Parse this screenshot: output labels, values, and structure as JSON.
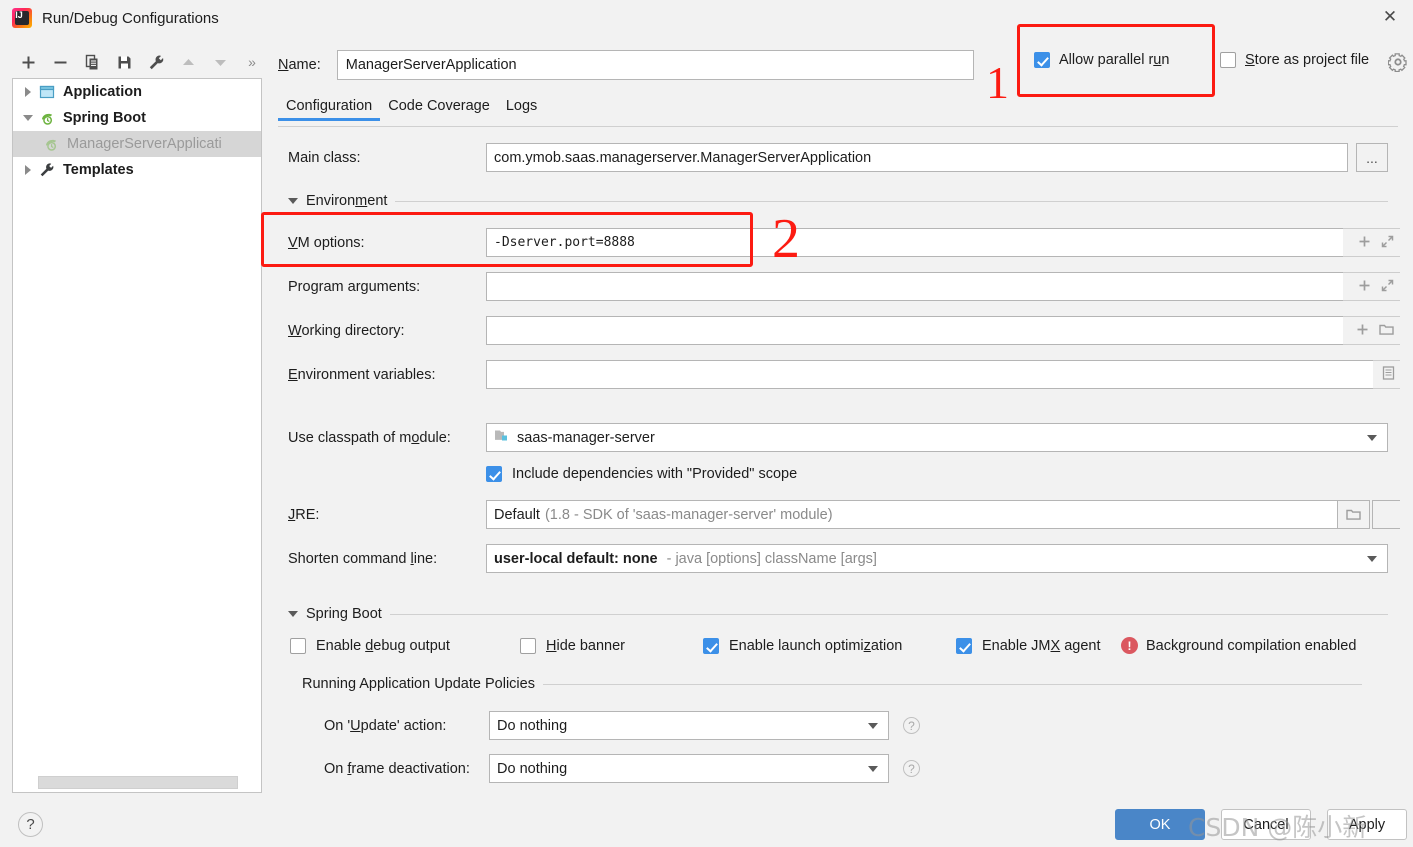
{
  "window": {
    "title": "Run/Debug Configurations",
    "app_icon": "intellij-idea-icon",
    "close_icon": "✕"
  },
  "toolbar": {
    "add_label": "+",
    "remove_label": "−",
    "copy_label": "copy-icon",
    "save_label": "save-icon",
    "edit_templates_label": "wrench-icon",
    "move_up_label": "move-up-icon",
    "move_down_label": "move-down-icon",
    "more_label": "»"
  },
  "tree": {
    "items": [
      {
        "label": "Application",
        "icon": "application-icon",
        "expanded": false,
        "selected": false,
        "child": false
      },
      {
        "label": "Spring Boot",
        "icon": "spring-boot-icon",
        "expanded": true,
        "selected": false,
        "child": false
      },
      {
        "label": "ManagerServerApplicati",
        "icon": "spring-boot-icon",
        "expanded": null,
        "selected": true,
        "child": true
      },
      {
        "label": "Templates",
        "icon": "wrench-icon",
        "expanded": false,
        "selected": false,
        "child": false
      }
    ]
  },
  "header": {
    "name_label": "Name:",
    "name_value": "ManagerServerApplication",
    "allow_parallel_run_label": "Allow parallel run",
    "allow_parallel_run_checked": true,
    "store_as_project_file_label": "Store as project file",
    "store_as_project_file_checked": false,
    "gear_icon": "gear-icon"
  },
  "tabs": [
    {
      "label": "Configuration",
      "active": true
    },
    {
      "label": "Code Coverage",
      "active": false
    },
    {
      "label": "Logs",
      "active": false
    }
  ],
  "form": {
    "main_class_label": "Main class:",
    "main_class_value": "com.ymob.saas.managerserver.ManagerServerApplication",
    "main_class_browse": "...",
    "environment_section": "Environment",
    "vm_options_label": "VM options:",
    "vm_options_value": "-Dserver.port=8888",
    "program_arguments_label": "Program arguments:",
    "program_arguments_value": "",
    "working_directory_label": "Working directory:",
    "working_directory_value": "",
    "environment_variables_label": "Environment variables:",
    "environment_variables_value": "",
    "use_classpath_label": "Use classpath of module:",
    "use_classpath_value": "saas-manager-server",
    "include_provided_label": "Include dependencies with \"Provided\" scope",
    "include_provided_checked": true,
    "jre_label": "JRE:",
    "jre_value": "Default",
    "jre_value_detail": "(1.8 - SDK of 'saas-manager-server' module)",
    "shorten_command_line_label": "Shorten command line:",
    "shorten_command_line_value": "user-local default: none",
    "shorten_command_line_detail": "- java [options] className [args]",
    "add_icon": "plus-icon",
    "expand_icon": "expand-icon",
    "folder_icon": "folder-icon",
    "list_icon": "list-icon",
    "dropdown_icon": "chevron-down-icon"
  },
  "spring_boot": {
    "section_title": "Spring Boot",
    "enable_debug_output_label": "Enable debug output",
    "enable_debug_output_checked": false,
    "hide_banner_label": "Hide banner",
    "hide_banner_checked": false,
    "enable_launch_optimization_label": "Enable launch optimization",
    "enable_launch_optimization_checked": true,
    "enable_jmx_agent_label": "Enable JMX agent",
    "enable_jmx_agent_checked": true,
    "background_compilation_label": "Background compilation enabled",
    "background_compilation_icon": "error-icon"
  },
  "update_policies": {
    "section_title": "Running Application Update Policies",
    "on_update_action_label": "On 'Update' action:",
    "on_update_action_value": "Do nothing",
    "on_frame_deactivation_label": "On frame deactivation:",
    "on_frame_deactivation_value": "Do nothing",
    "help_icon": "help-icon"
  },
  "footer": {
    "help_label": "?",
    "ok_label": "OK",
    "cancel_label": "Cancel",
    "apply_label": "Apply"
  },
  "annotations": {
    "mark_one": "1",
    "mark_two": "2"
  },
  "watermark": {
    "text": "CSDN @陈小新"
  },
  "colors": {
    "accent": "#3c90e8",
    "primary_button": "#4a86c8",
    "annotation": "#fc1b12",
    "error": "#db5860"
  }
}
